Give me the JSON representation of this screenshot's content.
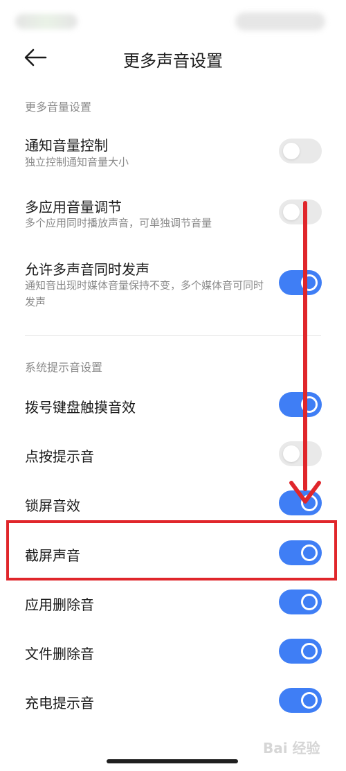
{
  "header": {
    "title": "更多声音设置",
    "back_icon": "arrow-left-icon"
  },
  "sections": {
    "volume": {
      "header": "更多音量设置",
      "items": [
        {
          "title": "通知音量控制",
          "subtitle": "独立控制通知音量大小",
          "enabled": false
        },
        {
          "title": "多应用音量调节",
          "subtitle": "多个应用同时播放声音，可单独调节音量",
          "enabled": false
        },
        {
          "title": "允许多声音同时发声",
          "subtitle": "通知音出现时媒体音量保持不变，多个媒体音可同时发声",
          "enabled": true
        }
      ]
    },
    "system": {
      "header": "系统提示音设置",
      "items": [
        {
          "title": "拨号键盘触摸音效",
          "enabled": true
        },
        {
          "title": "点按提示音",
          "enabled": false
        },
        {
          "title": "锁屏音效",
          "enabled": true
        },
        {
          "title": "截屏声音",
          "enabled": true
        },
        {
          "title": "应用删除音",
          "enabled": true
        },
        {
          "title": "文件删除音",
          "enabled": true
        },
        {
          "title": "充电提示音",
          "enabled": true
        }
      ]
    }
  },
  "annotation": {
    "highlight_color": "#e0262b",
    "arrow_color": "#e0262b",
    "highlighted_item": "截屏声音"
  },
  "colors": {
    "toggle_on": "#3f7ef5",
    "toggle_off": "#e9e9e9"
  },
  "watermark": {
    "text": "Bai 经验"
  }
}
